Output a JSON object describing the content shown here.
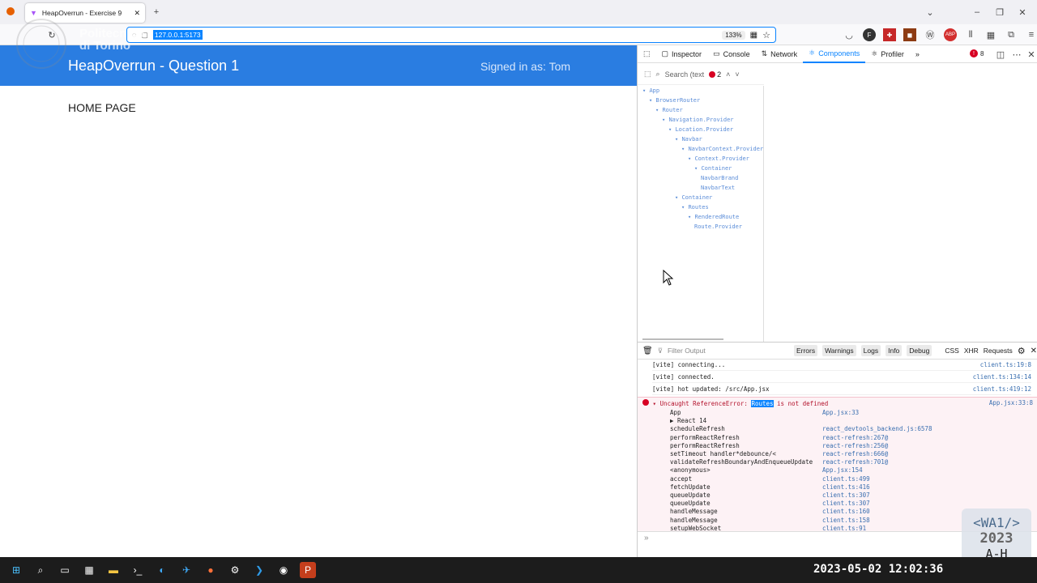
{
  "browser": {
    "tab_title": "HeapOverrun - Exercise 9",
    "url": "127.0.0.1:5173",
    "zoom": "133%"
  },
  "app": {
    "watermark_text": "Politecnico di Torino",
    "brand": "HeapOverrun - Question 1",
    "signed_in": "Signed in as: Tom",
    "home_title": "HOME PAGE"
  },
  "devtools": {
    "tabs": [
      "Inspector",
      "Console",
      "Network",
      "Components",
      "Profiler"
    ],
    "active_tab": "Components",
    "error_badge": "8",
    "search_placeholder": "Search (text",
    "component_errors": "2",
    "tree": [
      {
        "name": "App",
        "depth": 0
      },
      {
        "name": "BrowserRouter",
        "depth": 1
      },
      {
        "name": "Router",
        "depth": 2
      },
      {
        "name": "Navigation.Provider",
        "depth": 3
      },
      {
        "name": "Location.Provider",
        "depth": 4
      },
      {
        "name": "Navbar",
        "depth": 5
      },
      {
        "name": "NavbarContext.Provider",
        "depth": 6
      },
      {
        "name": "Context.Provider",
        "depth": 7
      },
      {
        "name": "Container",
        "depth": 8
      },
      {
        "name": "NavbarBrand",
        "depth": 9
      },
      {
        "name": "NavbarText",
        "depth": 9
      },
      {
        "name": "Container",
        "depth": 5
      },
      {
        "name": "Routes",
        "depth": 6
      },
      {
        "name": "RenderedRoute",
        "depth": 7
      },
      {
        "name": "Route.Provider",
        "depth": 8
      }
    ],
    "console_filter_placeholder": "Filter Output",
    "console_filters": [
      "Errors",
      "Warnings",
      "Logs",
      "Info",
      "Debug"
    ],
    "console_extra_filters": [
      "CSS",
      "XHR",
      "Requests"
    ],
    "logs": [
      {
        "text": "[vite] connecting...",
        "src": "client.ts:19:8"
      },
      {
        "text": "[vite] connected.",
        "src": "client.ts:134:14"
      },
      {
        "text": "[vite] hot updated: /src/App.jsx",
        "src": "client.ts:419:12"
      }
    ],
    "error": {
      "prefix": "Uncaught ReferenceError: ",
      "highlight": "Routes",
      "suffix": " is not defined",
      "src": "App.jsx:33:8"
    },
    "stack": [
      {
        "fn": "App",
        "loc": "App.jsx:33"
      },
      {
        "fn": "▶ React 14",
        "loc": ""
      },
      {
        "fn": "scheduleRefresh",
        "loc": "react_devtools_backend.js:6578"
      },
      {
        "fn": "performReactRefresh",
        "loc": "react-refresh:267@"
      },
      {
        "fn": "performReactRefresh",
        "loc": "react-refresh:256@"
      },
      {
        "fn": "setTimeout handler*debounce/<",
        "loc": "react-refresh:666@"
      },
      {
        "fn": "validateRefreshBoundaryAndEnqueueUpdate",
        "loc": "react-refresh:701@"
      },
      {
        "fn": "<anonymous>",
        "loc": "App.jsx:154"
      },
      {
        "fn": "accept",
        "loc": "client.ts:499"
      },
      {
        "fn": "fetchUpdate",
        "loc": "client.ts:416"
      },
      {
        "fn": "queueUpdate",
        "loc": "client.ts:307"
      },
      {
        "fn": "queueUpdate",
        "loc": "client.ts:307"
      },
      {
        "fn": "handleMessage",
        "loc": "client.ts:160"
      },
      {
        "fn": "handleMessage",
        "loc": "client.ts:158"
      },
      {
        "fn": "setupWebSocket",
        "loc": "client.ts:91"
      }
    ],
    "prompt": "»"
  },
  "overlay": {
    "course_tag": "<WA1/>",
    "year": "2023",
    "group": "A-H",
    "clock": "2023-05-02 12:02:36"
  },
  "colors": {
    "app_header": "#2a7de1",
    "devtools_accent": "#0a84ff",
    "error_text": "#b3112b"
  }
}
